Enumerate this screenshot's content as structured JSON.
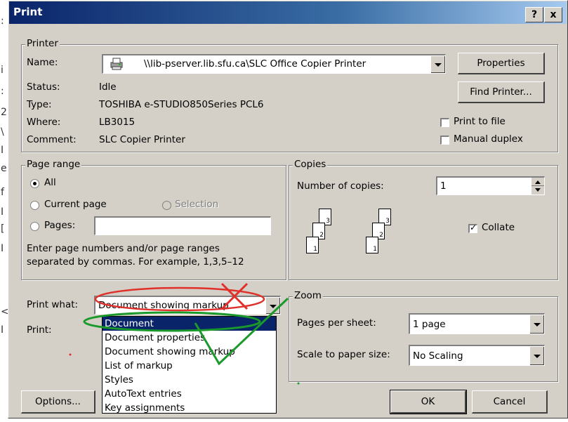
{
  "window": {
    "title": "Print",
    "help_btn": "?",
    "close_btn": "x"
  },
  "printer": {
    "group_label": "Printer",
    "name_label": "Name:",
    "name_value": "\\\\lib-pserver.lib.sfu.ca\\SLC Office Copier Printer",
    "status_label": "Status:",
    "status_value": "Idle",
    "type_label": "Type:",
    "type_value": "TOSHIBA e-STUDIO850Series PCL6",
    "where_label": "Where:",
    "where_value": "LB3015",
    "comment_label": "Comment:",
    "comment_value": "SLC Copier Printer",
    "properties_btn": "Properties",
    "find_printer_btn": "Find Printer...",
    "print_to_file": "Print to file",
    "manual_duplex": "Manual duplex"
  },
  "page_range": {
    "group_label": "Page range",
    "all": "All",
    "current_page": "Current page",
    "selection": "Selection",
    "pages": "Pages:",
    "pages_value": "",
    "hint_line1": "Enter page numbers and/or page ranges",
    "hint_line2": "separated by commas.  For example, 1,3,5–12"
  },
  "copies": {
    "group_label": "Copies",
    "number_label": "Number of copies:",
    "number_value": "1",
    "collate": "Collate",
    "collate_checked": true,
    "page_nums": [
      "3",
      "2",
      "1"
    ]
  },
  "print_what": {
    "label": "Print what:",
    "selected": "Document showing markup",
    "print_label": "Print:",
    "options": [
      "Document",
      "Document properties",
      "Document showing markup",
      "List of markup",
      "Styles",
      "AutoText entries",
      "Key assignments"
    ],
    "highlighted_index": 0
  },
  "zoom": {
    "group_label": "Zoom",
    "pages_per_sheet_label": "Pages per sheet:",
    "pages_per_sheet_value": "1 page",
    "scale_label": "Scale to paper size:",
    "scale_value": "No Scaling"
  },
  "buttons": {
    "options": "Options...",
    "ok": "OK",
    "cancel": "Cancel"
  },
  "annotation_colors": {
    "red": "#e0302a",
    "green": "#1a9a2a"
  },
  "background_chars": [
    ":",
    "i",
    ":",
    "2",
    "\\",
    "I",
    "e",
    "f",
    "I",
    "[",
    "I",
    "<",
    "I",
    "I"
  ]
}
